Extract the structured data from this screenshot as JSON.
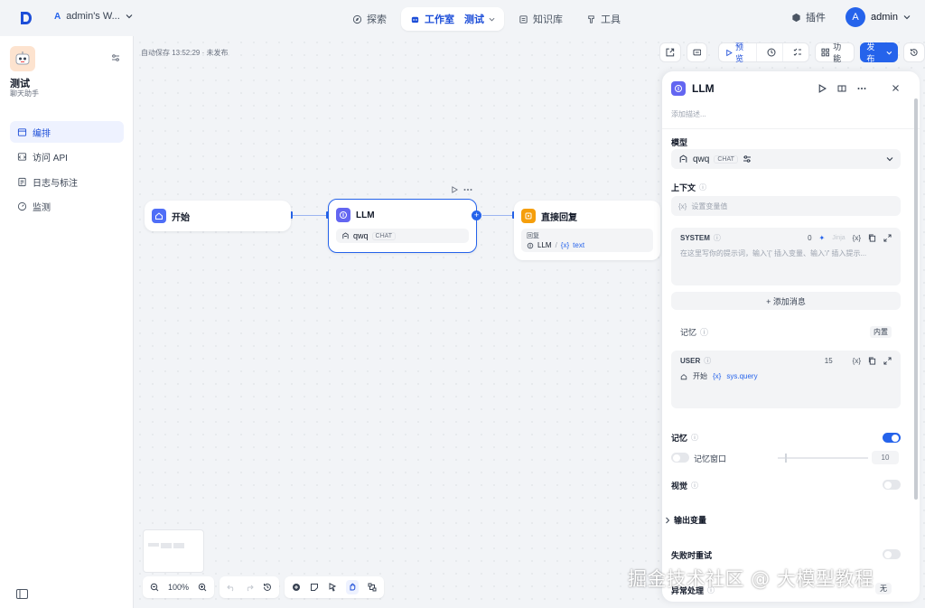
{
  "header": {
    "workspace_initial": "A",
    "workspace_name": "admin's W...",
    "nav": [
      {
        "label": "探索"
      },
      {
        "label": "工作室",
        "sub": "测试"
      },
      {
        "label": "知识库"
      },
      {
        "label": "工具"
      }
    ],
    "plugin_label": "插件",
    "user_initial": "A",
    "user_name": "admin"
  },
  "sidebar": {
    "app_name": "测试",
    "app_type": "聊天助手",
    "items": [
      {
        "label": "编排",
        "icon": "layout-icon"
      },
      {
        "label": "访问 API",
        "icon": "api-icon"
      },
      {
        "label": "日志与标注",
        "icon": "log-icon"
      },
      {
        "label": "监测",
        "icon": "monitor-icon"
      }
    ]
  },
  "canvas": {
    "autosave": "自动保存 13:52:29 · 未发布",
    "toolbar": {
      "preview": "预览",
      "features": "功能",
      "publish": "发布"
    },
    "nodes": {
      "start": {
        "title": "开始"
      },
      "llm": {
        "title": "LLM",
        "model": "qwq",
        "model_tag": "CHAT"
      },
      "reply": {
        "title": "直接回复",
        "label": "回复",
        "var_source": "LLM",
        "var_name": "text"
      }
    },
    "zoom": "100%"
  },
  "panel": {
    "title": "LLM",
    "desc_placeholder": "添加描述...",
    "model_label": "模型",
    "model_name": "qwq",
    "model_tag": "CHAT",
    "context_label": "上下文",
    "context_placeholder": "设置变量值",
    "system_label": "SYSTEM",
    "system_count": "0",
    "system_jinja": "Jinja",
    "system_placeholder": "在这里写你的提示词，输入'{' 插入变量、输入'/' 插入提示...",
    "add_message": "+ 添加消息",
    "memory_label": "记忆",
    "memory_value": "内置",
    "user_label": "USER",
    "user_count": "15",
    "user_var_source": "开始",
    "user_var_name": "sys.query",
    "memory_toggle_label": "记忆",
    "window_label": "记忆窗口",
    "window_value": "10",
    "vision_label": "视觉",
    "output_label": "输出变量",
    "retry_label": "失败时重试",
    "error_label": "异常处理",
    "error_value": "无"
  },
  "watermark": "掘金技术社区 @ 大模型教程",
  "colors": {
    "accent": "#2563eb",
    "start_node": "#4f6ef7",
    "llm_node": "#6366f1",
    "reply_node": "#f59e0b"
  }
}
